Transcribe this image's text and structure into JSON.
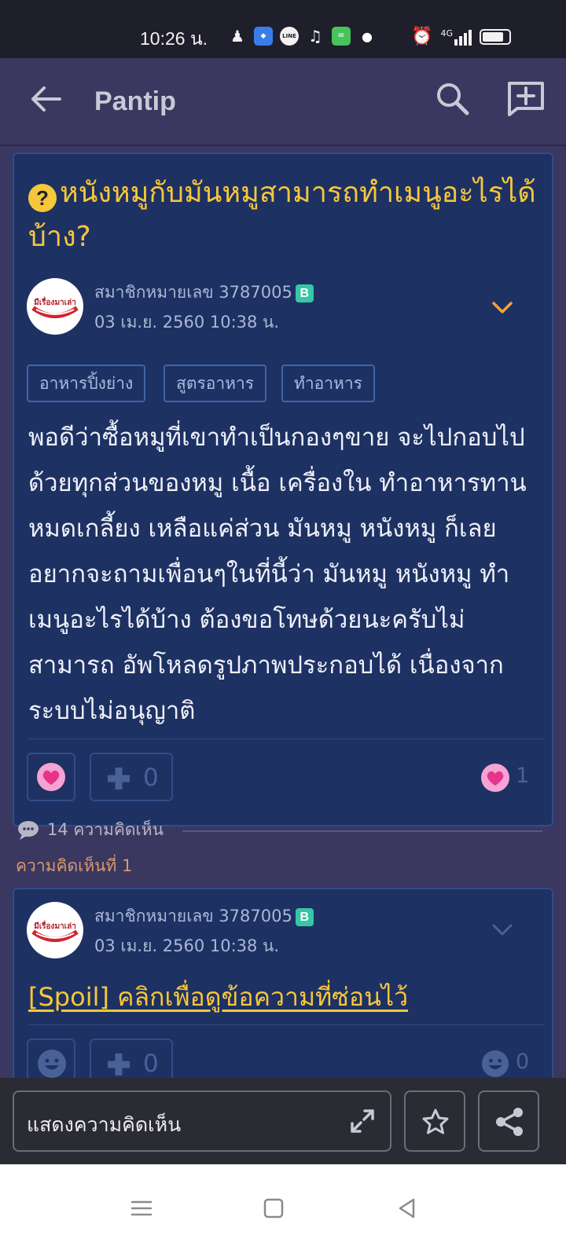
{
  "status_bar": {
    "time": "10:26 น.",
    "network": "4G"
  },
  "app_bar": {
    "title": "Pantip",
    "icons": [
      "back-arrow-icon",
      "search-icon",
      "compose-icon"
    ]
  },
  "post": {
    "title": "หนังหมูกับมันหมูสามารถทำเมนูอะไรได้บ้าง?",
    "author": "สมาชิกหมายเลข 3787005",
    "author_badge": "B",
    "date": "03 เม.ย. 2560 10:38 น.",
    "tags": [
      "อาหารปิ้งย่าง",
      "สูตรอาหาร",
      "ทำอาหาร"
    ],
    "body": "พอดีว่าซื้อหมูที่เขาทำเป็นกองๆขาย จะไปกอบไปด้วยทุกส่วนของหมู เนื้อ เครื่องใน ทำอาหารทานหมดเกลี้ยง เหลือแค่ส่วน มันหมู หนังหมู ก็เลยอยากจะถามเพื่อนๆในที่นี้ว่า มันหมู หนังหมู ทำเมนูอะไรได้บ้าง ต้องขอโทษด้วยนะครับไม่สามารถ อัพโหลดรูปภาพประกอบได้ เนื่องจากระบบไม่อนุญาติ",
    "plus_count": "0",
    "emotion_count": "1"
  },
  "comments_summary": {
    "count_label": "14 ความคิดเห็น",
    "first_label": "ความคิดเห็นที่ 1"
  },
  "comment1": {
    "author": "สมาชิกหมายเลข 3787005",
    "author_badge": "B",
    "date": "03 เม.ย. 2560 10:38 น.",
    "spoil_text": "[Spoil] คลิกเพื่อดูข้อความที่ซ่อนไว้",
    "plus_count": "0",
    "emotion_count": "0"
  },
  "input_bar": {
    "placeholder": "แสดงความคิดเห็น"
  },
  "colors": {
    "accent_yellow": "#f6c63b",
    "card_bg": "#1e3163",
    "page_bg": "#3a3760"
  }
}
